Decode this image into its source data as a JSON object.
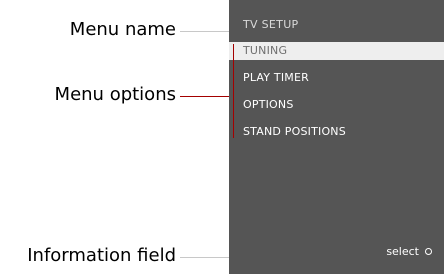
{
  "callouts": {
    "menu_name": "Menu name",
    "menu_options": "Menu options",
    "information_field": "Information field"
  },
  "screen": {
    "title": "TV SETUP",
    "items": [
      {
        "label": "TUNING",
        "selected": true
      },
      {
        "label": "PLAY TIMER",
        "selected": false
      },
      {
        "label": "OPTIONS",
        "selected": false
      },
      {
        "label": "STAND POSITIONS",
        "selected": false
      }
    ],
    "info": {
      "label": "select",
      "icon": "ring-icon"
    }
  },
  "colors": {
    "screen_bg": "#555555",
    "selected_bg": "#eeeeee",
    "leader_grey": "#c8c8c8",
    "leader_red": "#a40000"
  }
}
